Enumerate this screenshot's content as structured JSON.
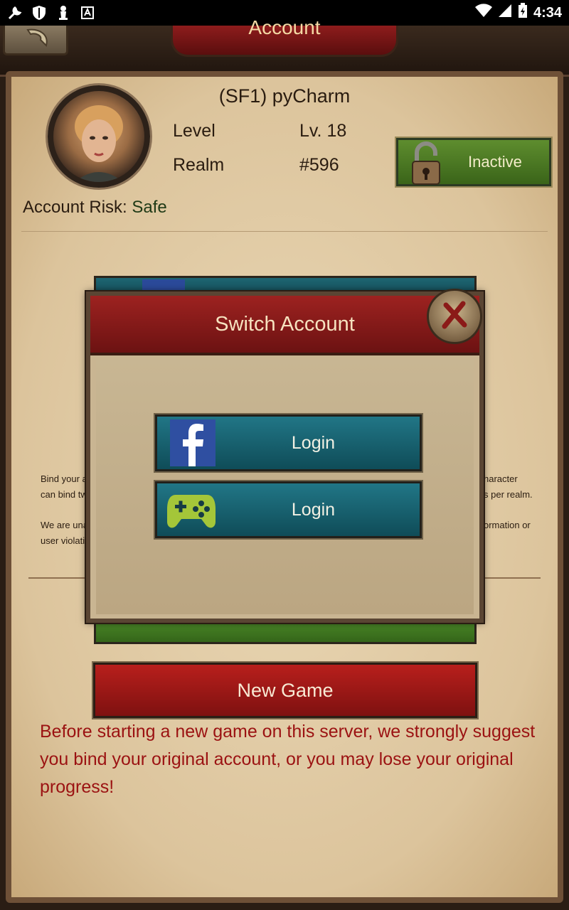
{
  "status_bar": {
    "time": "4:34",
    "left_icons": [
      "wrench-icon",
      "shield-icon",
      "chess-piece-icon",
      "notification-icon"
    ],
    "right_icons": [
      "wifi-icon",
      "signal-icon",
      "battery-icon"
    ]
  },
  "header": {
    "title": "Account"
  },
  "profile": {
    "name": "(SF1) pyCharm",
    "level_label": "Level",
    "level_value": "Lv. 18",
    "realm_label": "Realm",
    "realm_value": "#596",
    "risk_label": "Account Risk: ",
    "risk_value": "Safe",
    "status_button_label": "Inactive"
  },
  "background_text": {
    "line1_left": "Bind your a",
    "line2_left": "can bind tw",
    "line3_left": "We are una",
    "line4_left": "user violati",
    "line1_right": "haracter",
    "line2_right": "s per realm.",
    "line3_right": "ormation or"
  },
  "dialog": {
    "title": "Switch Account",
    "facebook_login_label": "Login",
    "google_login_label": "Login"
  },
  "new_game_button_label": "New Game",
  "warning": "Before starting a new game on this server, we strongly suggest you bind your original account, or you may lose your original progress!",
  "colors": {
    "accent_red": "#9b1212",
    "teal_button": "#217686",
    "green_button": "#5e8d2e",
    "parchment": "#e5d2ad"
  }
}
